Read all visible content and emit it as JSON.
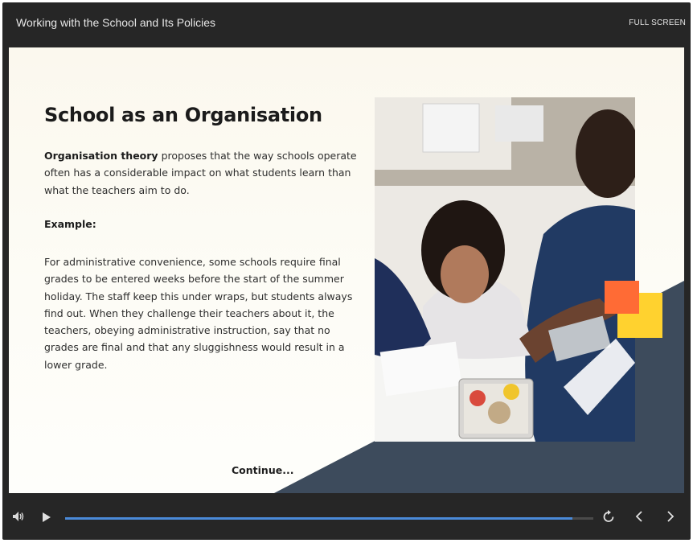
{
  "topbar": {
    "title": "Working with the School and Its Policies",
    "fullscreen_label": "FULL SCREEN"
  },
  "slide": {
    "heading": "School as an Organisation",
    "paragraph1_bold": "Organisation theory",
    "paragraph1_rest": " proposes that the way schools operate often has a considerable impact on what students learn than what the teachers aim to do.",
    "example_label": "Example:",
    "paragraph3": "For administrative convenience, some schools require final grades to be entered weeks before the start of the summer holiday. The staff keep this under wraps, but students always find out. When they challenge their teachers about it, the teachers, obeying administrative instruction, say that no grades are final and that any sluggishness would result in a lower grade.",
    "continue_label": "Continue..."
  },
  "colors": {
    "accent_orange": "#ff6b35",
    "accent_yellow": "#ffd22f",
    "slate": "#3d4b5c",
    "progress": "#4a8ad8"
  },
  "controls": {
    "progress_fraction": 0.96,
    "icons": [
      "volume-icon",
      "play-icon",
      "replay-icon",
      "chevron-left-icon",
      "chevron-right-icon"
    ]
  }
}
